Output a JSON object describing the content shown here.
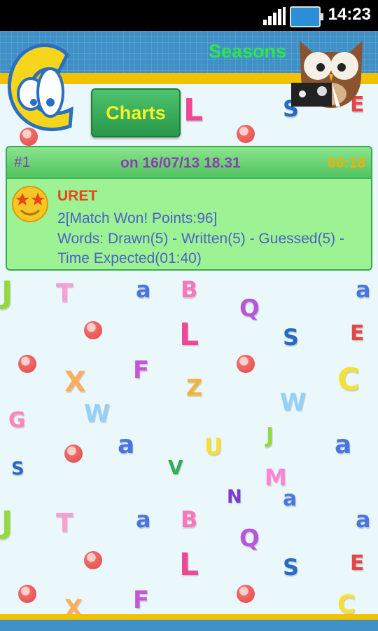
{
  "status_bar": {
    "time": "14:23"
  },
  "header": {
    "title": "Seasons",
    "charts_button": "Charts"
  },
  "entry": {
    "rank": "#1",
    "date": "on 16/07/13 18.31",
    "duration": "00:18",
    "player": "URET",
    "line1": "2[Match Won!  Points:96]",
    "line2": "Words: Drawn(5) - Written(5) - Guessed(5) -",
    "line3": "Time Expected(01:40)"
  },
  "icons": {
    "logo": "letter-c-mascot-icon",
    "owl": "owl-mascot-icon",
    "smiley": "star-eyes-smiley-icon",
    "signal": "signal-icon",
    "battery": "battery-icon"
  },
  "colors": {
    "title_green": "#2de54a",
    "header_blue": "#3e90c6",
    "stripe_yellow": "#f2c200",
    "card_green": "#9df294",
    "purple_text": "#8a3fb0",
    "orange_text": "#e8451a",
    "blue_text": "#4a63c4",
    "timer_yellow": "#f2b000"
  }
}
